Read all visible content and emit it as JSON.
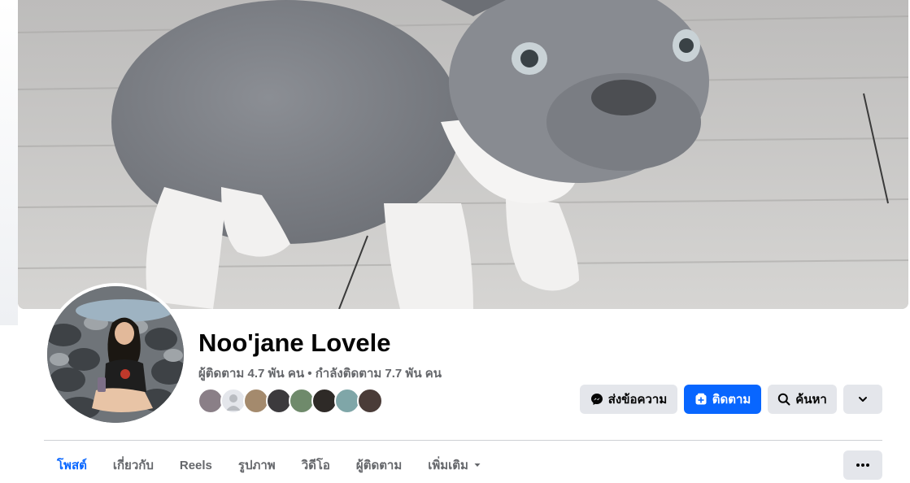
{
  "profile": {
    "name": "Noo'jane Lovele",
    "stats": "ผู้ติดตาม 4.7 พัน คน • กำลังติดตาม 7.7 พัน คน"
  },
  "cover": {
    "subject": "grey-white-french-bulldog-puppy"
  },
  "actions": {
    "message_label": "ส่งข้อความ",
    "follow_label": "ติดตาม",
    "search_label": "ค้นหา"
  },
  "tabs": [
    {
      "label": "โพสต์",
      "active": true
    },
    {
      "label": "เกี่ยวกับ"
    },
    {
      "label": "Reels"
    },
    {
      "label": "รูปภาพ"
    },
    {
      "label": "วิดีโอ"
    },
    {
      "label": "ผู้ติดตาม"
    },
    {
      "label": "เพิ่มเติม"
    }
  ],
  "friend_avatars": [
    "friend-avatar-1",
    "friend-avatar-2",
    "friend-avatar-3",
    "friend-avatar-4",
    "friend-avatar-5",
    "friend-avatar-6",
    "friend-avatar-7",
    "friend-avatar-8"
  ],
  "colors": {
    "accent": "#0866ff",
    "button_gray": "#e4e6eb",
    "text_secondary": "#65676b"
  }
}
